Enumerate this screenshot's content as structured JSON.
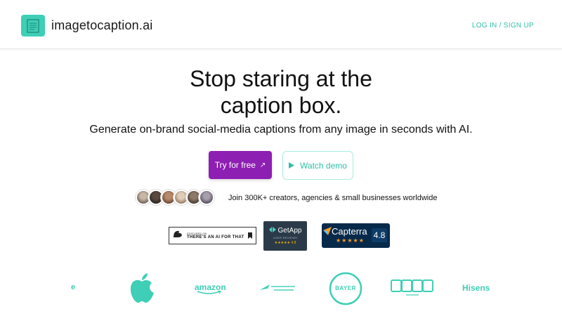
{
  "header": {
    "logo_text": "imagetocaption.ai",
    "login_label": "LOG IN / SIGN UP"
  },
  "hero": {
    "headline_line1": "Stop staring at the",
    "headline_line2": "caption box.",
    "subheadline": "Generate on-brand social-media captions from any image in seconds with AI.",
    "try_button": "Try for free",
    "try_icon": "↗",
    "demo_button": "Watch demo"
  },
  "social_proof": {
    "join_text": "Join 300K+ creators, agencies & small businesses worldwide",
    "avatar_count": 6
  },
  "badges": {
    "aiftt_small": "FEATURED ON",
    "aiftt_big": "THERE'S AN AI FOR THAT",
    "getapp_title": "GetApp",
    "getapp_sub": "USER REVIEWS",
    "getapp_rating": "★★★★★ 4.8",
    "capterra_title": "Capterra",
    "capterra_stars": "★★★★★",
    "capterra_score": "4.8"
  },
  "brands": {
    "partial": "e",
    "amazon": "amazon",
    "bayer": "BAYER",
    "hisense": "Hisens"
  },
  "colors": {
    "accent_teal": "#3ecfb6",
    "primary_purple": "#8e1fb3"
  }
}
